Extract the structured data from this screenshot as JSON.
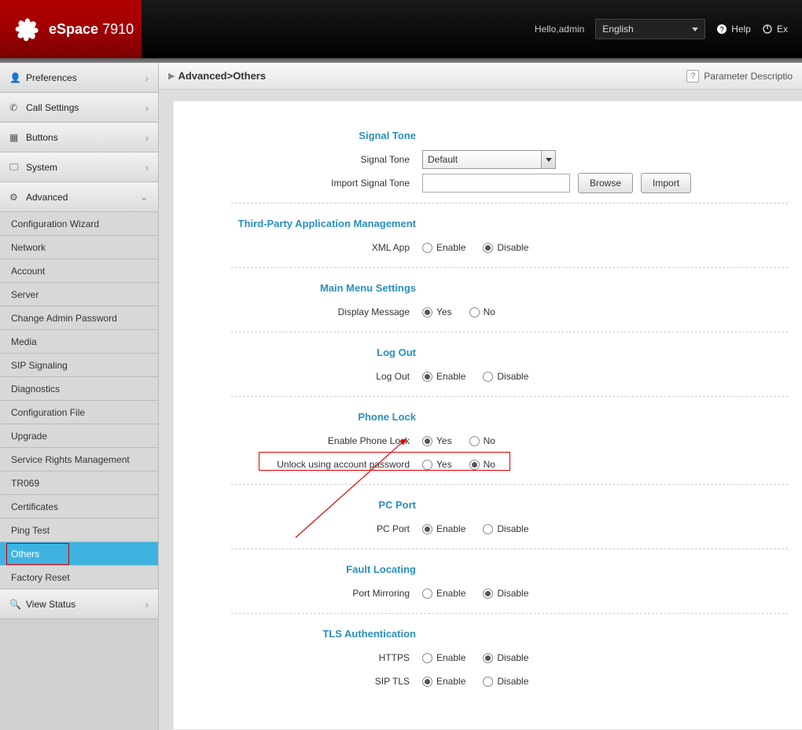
{
  "header": {
    "product_brand": "eSpace",
    "product_model": "7910",
    "greeting": "Hello,admin",
    "language": "English",
    "help_label": "Help",
    "exit_label": "Ex"
  },
  "breadcrumb": {
    "path": "Advanced>Others",
    "param_desc": "Parameter Descriptio"
  },
  "sidebar": {
    "preferences": "Preferences",
    "call_settings": "Call Settings",
    "buttons": "Buttons",
    "system": "System",
    "advanced": "Advanced",
    "view_status": "View Status",
    "sub": {
      "config_wizard": "Configuration Wizard",
      "network": "Network",
      "account": "Account",
      "server": "Server",
      "change_pwd": "Change Admin Password",
      "media": "Media",
      "sip": "SIP Signaling",
      "diagnostics": "Diagnostics",
      "config_file": "Configuration File",
      "upgrade": "Upgrade",
      "srm": "Service Rights Management",
      "tr069": "TR069",
      "certs": "Certificates",
      "ping": "Ping Test",
      "others": "Others",
      "factory_reset": "Factory Reset"
    }
  },
  "form": {
    "signal_tone_section": "Signal Tone",
    "signal_tone_label": "Signal Tone",
    "signal_tone_value": "Default",
    "import_signal_tone_label": "Import Signal Tone",
    "browse_btn": "Browse",
    "import_btn": "Import",
    "third_party_section": "Third-Party Application Management",
    "xml_app_label": "XML App",
    "enable": "Enable",
    "disable": "Disable",
    "main_menu_section": "Main Menu Settings",
    "display_message_label": "Display Message",
    "yes": "Yes",
    "no": "No",
    "logout_section": "Log Out",
    "logout_label": "Log Out",
    "phone_lock_section": "Phone Lock",
    "enable_phone_lock_label": "Enable Phone Lock",
    "unlock_pwd_label": "Unlock using account password",
    "pc_port_section": "PC Port",
    "pc_port_label": "PC Port",
    "fault_section": "Fault Locating",
    "port_mirroring_label": "Port Mirroring",
    "tls_section": "TLS Authentication",
    "https_label": "HTTPS",
    "sip_tls_label": "SIP TLS"
  }
}
